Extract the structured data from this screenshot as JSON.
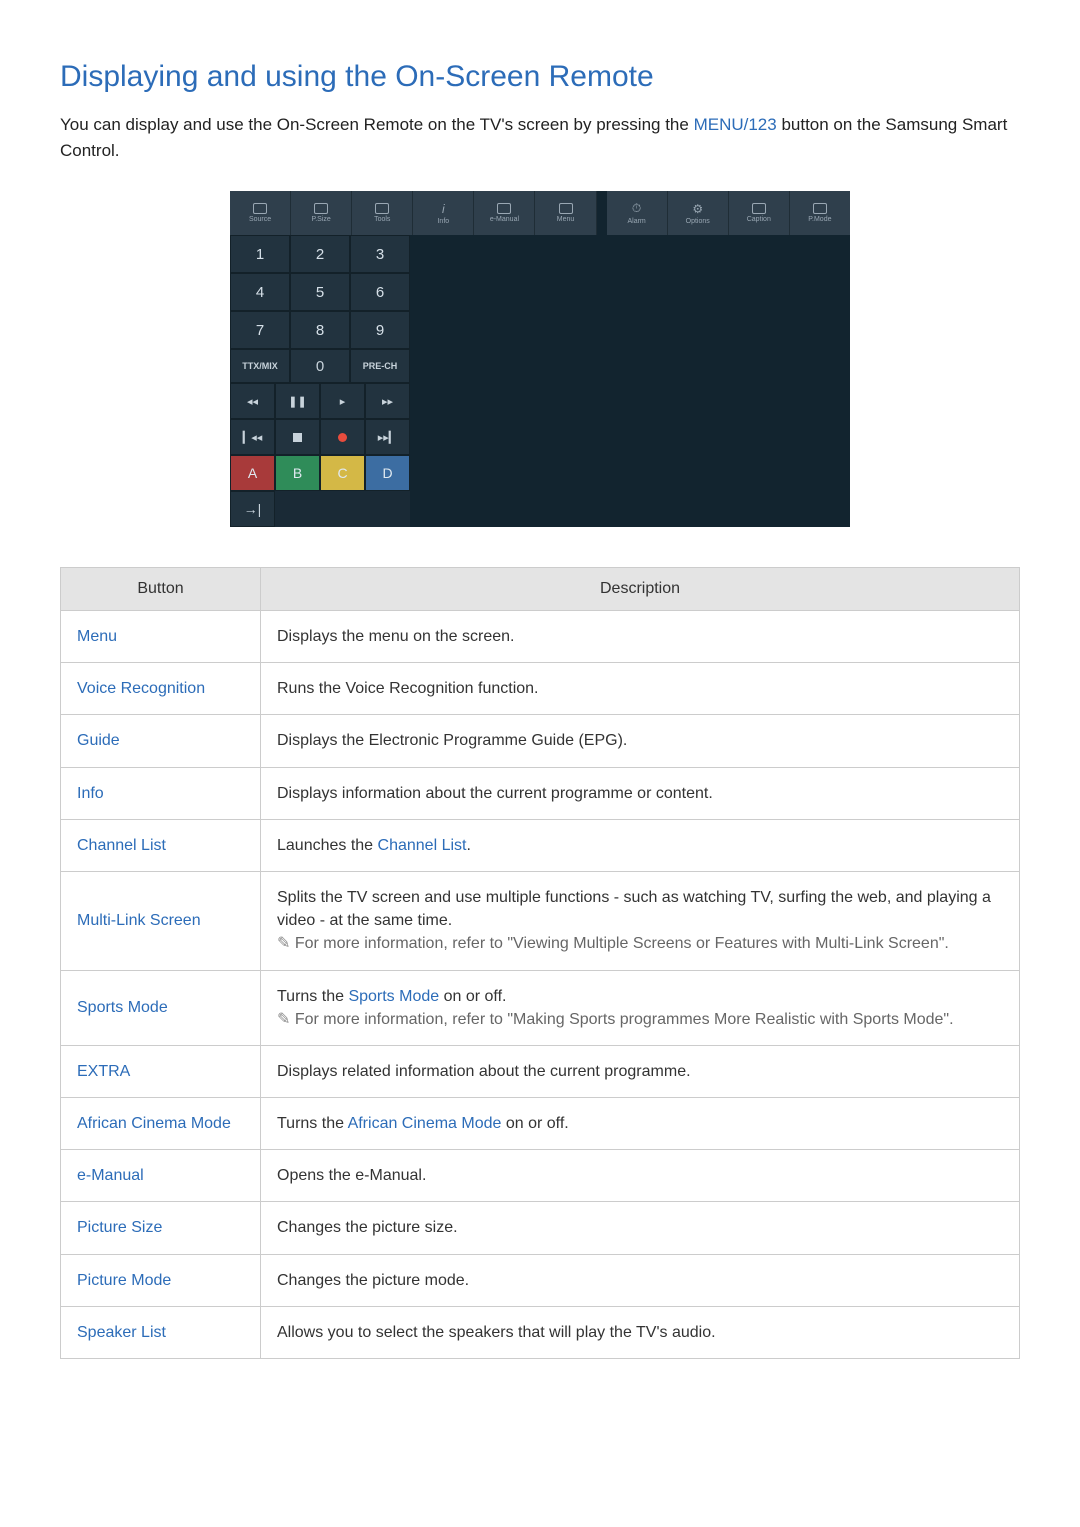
{
  "title": "Displaying and using the On-Screen Remote",
  "intro_a": "You can display and use the On-Screen Remote on the TV's screen by pressing the ",
  "intro_kw": "MENU/123",
  "intro_b": " button on the Samsung Smart Control.",
  "top_icons": [
    "Source",
    "P.Size",
    "Tools",
    "Info",
    "e-Manual",
    "Menu",
    "Alarm",
    "Options",
    "Caption",
    "P.Mode"
  ],
  "numpad": {
    "r1": [
      "1",
      "2",
      "3"
    ],
    "r2": [
      "4",
      "5",
      "6"
    ],
    "r3": [
      "7",
      "8",
      "9"
    ],
    "r4_left": "TTX/MIX",
    "r4_mid": "0",
    "r4_right": "PRE-CH"
  },
  "media": {
    "rew": "◂◂",
    "pause": "❚❚",
    "play": "▸",
    "ff": "▸▸",
    "prev": "▎◂◂",
    "next": "▸▸▎"
  },
  "colorbtn": {
    "A": "A",
    "B": "B",
    "C": "C",
    "D": "D"
  },
  "exit": "→|",
  "table": {
    "h1": "Button",
    "h2": "Description",
    "rows": [
      {
        "b": "Menu",
        "d": "Displays the menu on the screen."
      },
      {
        "b": "Voice Recognition",
        "d": "Runs the Voice Recognition function."
      },
      {
        "b": "Guide",
        "d": "Displays the Electronic Programme Guide (EPG)."
      },
      {
        "b": "Info",
        "d": "Displays information about the current programme or content."
      },
      {
        "b": "Channel List",
        "d_pre": "Launches the ",
        "d_link": "Channel List",
        "d_post": "."
      },
      {
        "b": "Multi-Link Screen",
        "d": "Splits the TV screen and use multiple functions - such as watching TV, surfing the web, and playing a video - at the same time.",
        "note": "For more information, refer to \"Viewing Multiple Screens or Features with Multi-Link Screen\"."
      },
      {
        "b": "Sports Mode",
        "d_pre": "Turns the ",
        "d_link": "Sports Mode",
        "d_post": " on or off.",
        "note": "For more information, refer to \"Making Sports programmes More Realistic with Sports Mode\"."
      },
      {
        "b": "EXTRA",
        "d": "Displays related information about the current programme."
      },
      {
        "b": "African Cinema Mode",
        "d_pre": "Turns the ",
        "d_link": "African Cinema Mode",
        "d_post": " on or off."
      },
      {
        "b": "e-Manual",
        "d": "Opens the e-Manual."
      },
      {
        "b": "Picture Size",
        "d": "Changes the picture size."
      },
      {
        "b": "Picture Mode",
        "d": "Changes the picture mode."
      },
      {
        "b": "Speaker List",
        "d": "Allows you to select the speakers that will play the TV's audio."
      }
    ]
  }
}
